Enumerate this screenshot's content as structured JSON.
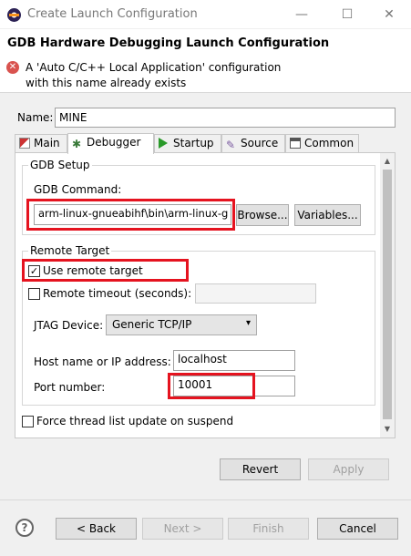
{
  "window": {
    "title": "Create Launch Configuration",
    "minimize": "—",
    "maximize": "☐",
    "close": "✕"
  },
  "header": {
    "title": "GDB Hardware Debugging Launch Configuration",
    "error_icon": "✕",
    "error_line1": "A 'Auto C/C++ Local Application' configuration",
    "error_line2": "with this name already exists"
  },
  "name": {
    "label": "Name:",
    "value": "MINE"
  },
  "tabs": [
    {
      "label": "Main",
      "icon": "main-tab-icon"
    },
    {
      "label": "Debugger",
      "icon": "debugger-tab-icon"
    },
    {
      "label": "Startup",
      "icon": "startup-tab-icon"
    },
    {
      "label": "Source",
      "icon": "source-tab-icon"
    },
    {
      "label": "Common",
      "icon": "common-tab-icon"
    }
  ],
  "gdb_setup": {
    "title": "GDB Setup",
    "command_label": "GDB Command:",
    "command_value": "arm-linux-gnueabihf\\bin\\arm-linux-g",
    "browse_label": "Browse...",
    "variables_label": "Variables..."
  },
  "remote_target": {
    "title": "Remote Target",
    "use_remote_label": "Use remote target",
    "use_remote_checked": "✓",
    "timeout_label": "Remote timeout (seconds):",
    "timeout_value": "",
    "jtag_label": "JTAG Device:",
    "jtag_value": "Generic TCP/IP",
    "host_label": "Host name or IP address:",
    "host_value": "localhost",
    "port_label": "Port number:",
    "port_value": "10001"
  },
  "force_thread_label": "Force thread list update on suspend",
  "panel_buttons": {
    "revert": "Revert",
    "apply": "Apply"
  },
  "footer": {
    "help": "?",
    "back": "< Back",
    "next": "Next >",
    "finish": "Finish",
    "cancel": "Cancel"
  },
  "colors": {
    "highlight_box": "#e5131f",
    "error_icon": "#d9534f"
  }
}
